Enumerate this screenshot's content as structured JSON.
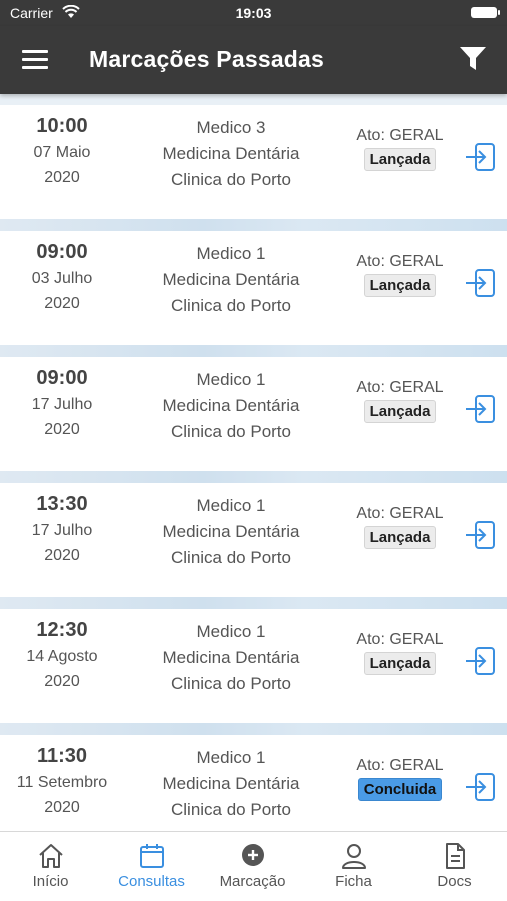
{
  "status": {
    "carrier": "Carrier",
    "time": "19:03"
  },
  "header": {
    "title": "Marcações Passadas"
  },
  "appointments": [
    {
      "time": "10:00",
      "day": "07 Maio",
      "year": "2020",
      "doctor": "Medico 3",
      "specialty": "Medicina Dentária",
      "clinic": "Clinica do Porto",
      "act": "Ato: GERAL",
      "status": "Lançada"
    },
    {
      "time": "09:00",
      "day": "03 Julho",
      "year": "2020",
      "doctor": "Medico 1",
      "specialty": "Medicina Dentária",
      "clinic": "Clinica do Porto",
      "act": "Ato: GERAL",
      "status": "Lançada"
    },
    {
      "time": "09:00",
      "day": "17 Julho",
      "year": "2020",
      "doctor": "Medico 1",
      "specialty": "Medicina Dentária",
      "clinic": "Clinica do Porto",
      "act": "Ato: GERAL",
      "status": "Lançada"
    },
    {
      "time": "13:30",
      "day": "17 Julho",
      "year": "2020",
      "doctor": "Medico 1",
      "specialty": "Medicina Dentária",
      "clinic": "Clinica do Porto",
      "act": "Ato: GERAL",
      "status": "Lançada"
    },
    {
      "time": "12:30",
      "day": "14 Agosto",
      "year": "2020",
      "doctor": "Medico 1",
      "specialty": "Medicina Dentária",
      "clinic": "Clinica do Porto",
      "act": "Ato: GERAL",
      "status": "Lançada"
    },
    {
      "time": "11:30",
      "day": "11 Setembro",
      "year": "2020",
      "doctor": "Medico 1",
      "specialty": "Medicina Dentária",
      "clinic": "Clinica do Porto",
      "act": "Ato: GERAL",
      "status": "Concluida"
    }
  ],
  "tabs": [
    {
      "label": "Início",
      "icon": "home-icon"
    },
    {
      "label": "Consultas",
      "icon": "calendar-icon"
    },
    {
      "label": "Marcação",
      "icon": "add-circle-icon"
    },
    {
      "label": "Ficha",
      "icon": "person-icon"
    },
    {
      "label": "Docs",
      "icon": "document-icon"
    }
  ],
  "active_tab": "Consultas",
  "colors": {
    "header": "#3a3a3a",
    "accent": "#3a8fe0",
    "concluida_badge": "#4a9be6"
  }
}
